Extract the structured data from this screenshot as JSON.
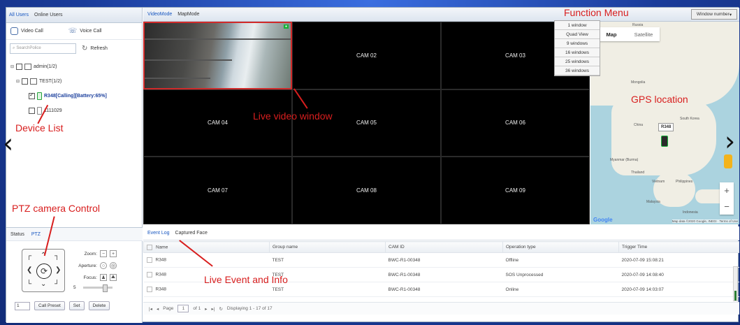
{
  "user_tabs": {
    "all": "All Users",
    "online": "Online Users"
  },
  "calls": {
    "video": "Video Call",
    "voice": "Voice Call"
  },
  "search": {
    "placeholder": "SearchPolice",
    "refresh": "Refresh"
  },
  "tree": [
    {
      "label": "admin(1/2)"
    },
    {
      "label": "TEST(1/2)"
    },
    {
      "label": "R348[Calling][Battery:65%]"
    },
    {
      "label": "1111029"
    }
  ],
  "ptz_tabs": {
    "status": "Status",
    "ptz": "PTZ"
  },
  "ptz_controls": {
    "zoom": "Zoom:",
    "aperture": "Aperture:",
    "focus": "Focus:",
    "speed": "5"
  },
  "preset": {
    "value": "1",
    "call": "Call Preset",
    "set": "Set",
    "delete": "Delete"
  },
  "mode_tabs": {
    "video": "VideoMode",
    "map": "MapMode"
  },
  "window_number": "Window number",
  "window_options": [
    "1 window",
    "Quad View",
    "9 windows",
    "16 windows",
    "25 windows",
    "36 windows"
  ],
  "cams": [
    "",
    "CAM 02",
    "CAM 03",
    "CAM 04",
    "CAM 05",
    "CAM 06",
    "CAM 07",
    "CAM 08",
    "CAM 09"
  ],
  "map": {
    "map": "Map",
    "satellite": "Satellite",
    "marker": "R348",
    "google": "Google",
    "copyright": "Map data ©2020 Google, INEGI · Terms of Use",
    "labels": {
      "mongolia": "Mongolia",
      "china": "China",
      "south_korea": "South Korea",
      "myanmar": "Myanmar (Burma)",
      "thailand": "Thailand",
      "vietnam": "Vietnam",
      "philippines": "Philippines",
      "malaysia": "Malaysia",
      "indonesia": "Indonesia",
      "russia": "Russia"
    }
  },
  "event_tabs": {
    "log": "Event Log",
    "faces": "Captured Face"
  },
  "table": {
    "headers": [
      "Name",
      "Group name",
      "CAM ID",
      "Operation type",
      "Trigger Time"
    ],
    "rows": [
      [
        "R348",
        "TEST",
        "BWC-R1-00348",
        "Offline",
        "2020-07-09 15:08:21"
      ],
      [
        "R348",
        "TEST",
        "BWC-R1-00348",
        "SOS Unprocessed",
        "2020-07-09 14:08:40"
      ],
      [
        "R348",
        "TEST",
        "BWC-R1-00348",
        "Online",
        "2020-07-09 14:03:07"
      ]
    ]
  },
  "pager": {
    "page": "Page",
    "current": "1",
    "of": "of 1",
    "display": "Displaying 1 - 17 of 17"
  },
  "annotations": {
    "function_menu": "Function Menu",
    "gps": "GPS location",
    "live_video": "Live video window",
    "device_list": "Device List",
    "ptz": "PTZ camera Control",
    "event": "Live Event and Info"
  }
}
